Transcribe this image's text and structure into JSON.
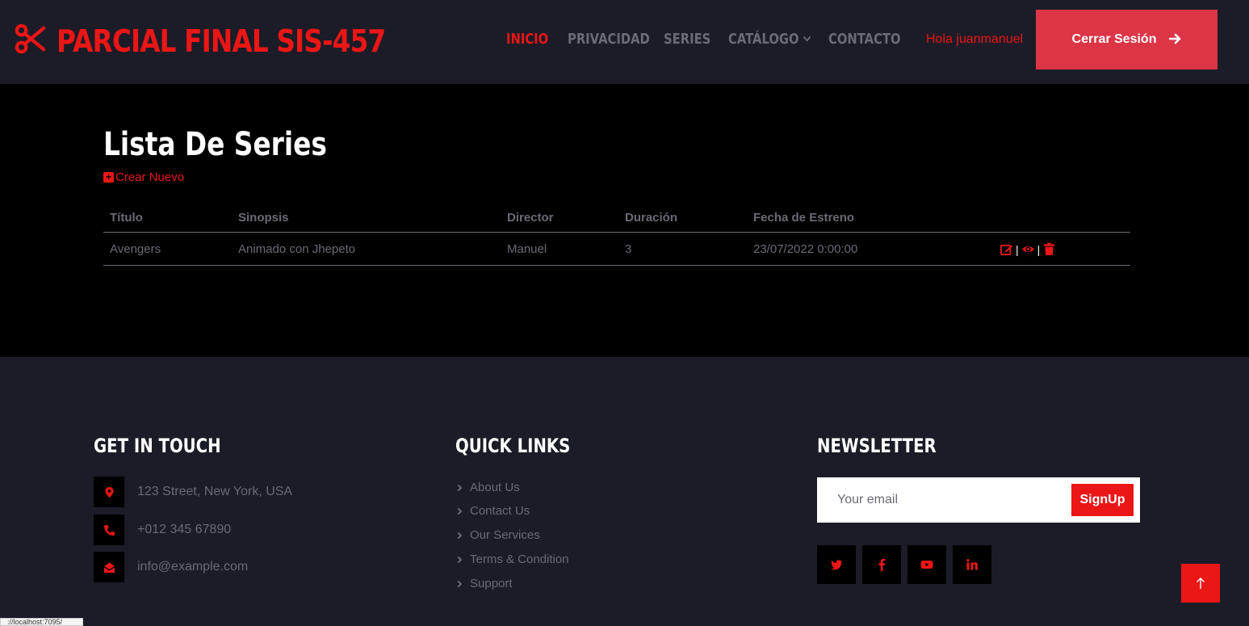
{
  "header": {
    "brand": "PARCIAL FINAL SIS-457",
    "nav": [
      {
        "label": "INICIO",
        "active": true
      },
      {
        "label": "PRIVACIDAD",
        "active": false
      },
      {
        "label": "SERIES",
        "active": false
      },
      {
        "label": "CATÁLOGO",
        "active": false
      },
      {
        "label": "CONTACTO",
        "active": false
      }
    ],
    "greeting": "Hola juanmanuel",
    "logout_label": "Cerrar Sesión"
  },
  "main": {
    "title": "Lista De Series",
    "create_label": "Crear Nuevo",
    "table": {
      "columns": [
        "Título",
        "Sinopsis",
        "Director",
        "Duración",
        "Fecha de Estreno"
      ],
      "rows": [
        [
          "Avengers",
          "Animado con Jhepeto",
          "Manuel",
          "3",
          "23/07/2022 0:00:00"
        ]
      ],
      "action_separator": "|"
    }
  },
  "footer": {
    "contact": {
      "heading": "GET IN TOUCH",
      "address": "123 Street, New York, USA",
      "phone": "+012 345 67890",
      "email": "info@example.com"
    },
    "quick_links": {
      "heading": "QUICK LINKS",
      "links": [
        "About Us",
        "Contact Us",
        "Our Services",
        "Terms & Condition",
        "Support"
      ]
    },
    "newsletter": {
      "heading": "NEWSLETTER",
      "placeholder": "Your email",
      "button_label": "SignUp"
    },
    "social_icons": [
      "twitter-icon",
      "facebook-icon",
      "youtube-icon",
      "linkedin-icon"
    ],
    "status_url": "://localhost:7095/"
  },
  "colors": {
    "accent": "#eb1616",
    "button_red": "#dc3545",
    "dark_bg": "#1b1c27",
    "black": "#000000",
    "muted_text": "#6b6a75"
  }
}
